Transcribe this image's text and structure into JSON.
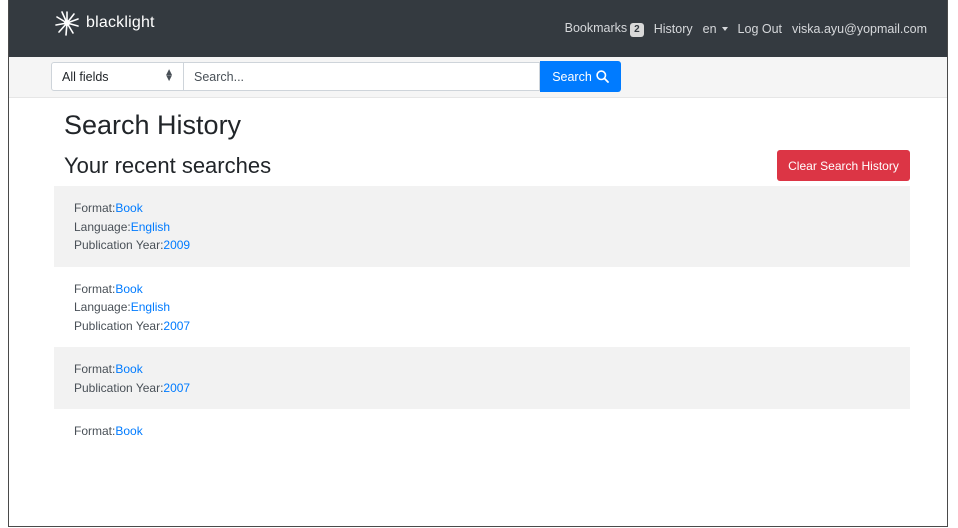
{
  "navbar": {
    "brand": "blacklight",
    "bookmarks_label": "Bookmarks",
    "bookmarks_count": "2",
    "history_label": "History",
    "language": "en",
    "logout_label": "Log Out",
    "user_email": "viska.ayu@yopmail.com",
    "background_color": "#343a40"
  },
  "search": {
    "field_selected": "All fields",
    "placeholder": "Search...",
    "button_label": "Search",
    "button_color": "#007bff"
  },
  "page": {
    "title": "Search History",
    "subtitle": "Your recent searches",
    "clear_button_label": "Clear Search History",
    "clear_button_color": "#dc3545"
  },
  "history": [
    {
      "criteria": [
        {
          "label": "Format:",
          "value": "Book"
        },
        {
          "label": "Language:",
          "value": "English"
        },
        {
          "label": "Publication Year:",
          "value": "2009"
        }
      ]
    },
    {
      "criteria": [
        {
          "label": "Format:",
          "value": "Book"
        },
        {
          "label": "Language:",
          "value": "English"
        },
        {
          "label": "Publication Year:",
          "value": "2007"
        }
      ]
    },
    {
      "criteria": [
        {
          "label": "Format:",
          "value": "Book"
        },
        {
          "label": "Publication Year:",
          "value": "2007"
        }
      ]
    },
    {
      "criteria": [
        {
          "label": "Format:",
          "value": "Book"
        }
      ]
    }
  ]
}
